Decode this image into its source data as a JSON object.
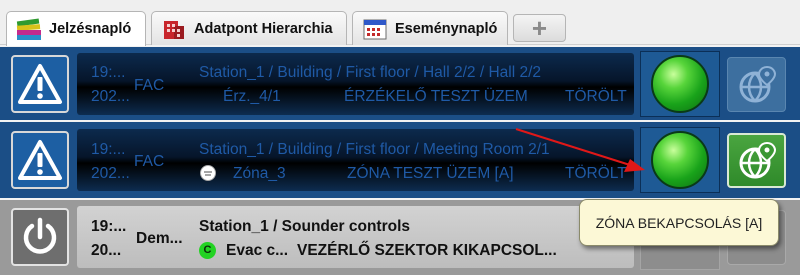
{
  "tabs": [
    {
      "label": "Jelzésnapló",
      "icon": "books-icon",
      "active": true
    },
    {
      "label": "Adatpont Hierarchia",
      "icon": "building-icon",
      "active": false
    },
    {
      "label": "Eseménynapló",
      "icon": "calendar-icon",
      "active": false
    }
  ],
  "add_tab_label": "+",
  "rows": [
    {
      "icon": "warning-icon",
      "time": "19:...",
      "date": "202...",
      "type": "FAC",
      "path": "Station_1 / Building / First floor / Hall 2/2 / Hall 2/2",
      "device": "Érz._4/1",
      "event": "ÉRZÉKELŐ TESZT ÜZEM",
      "status": "TÖRÖLT",
      "lamp_color": "#19a31a"
    },
    {
      "icon": "warning-icon",
      "time": "19:...",
      "date": "202...",
      "type": "FAC",
      "path": "Station_1 / Building / First floor / Meeting Room 2/1",
      "device": "Zóna_3",
      "event": "ZÓNA TESZT ÜZEM [A]",
      "status": "TÖRÖLT",
      "lamp_color": "#19a31a"
    },
    {
      "icon": "power-icon",
      "time": "19:...",
      "date": "20...",
      "type": "Dem...",
      "path": "Station_1 / Sounder controls",
      "badge": "C",
      "device": "Evac c...",
      "event": "VEZÉRLŐ SZEKTOR KIKAPCSOL..."
    }
  ],
  "tooltip": "ZÓNA BEKAPCSOLÁS [A]",
  "colors": {
    "row_bg": "#1b4e86",
    "row_text": "#1f5aa6",
    "lamp": "#19a31a",
    "arrow": "#e01818",
    "tooltip_bg": "#fcf8d6"
  }
}
